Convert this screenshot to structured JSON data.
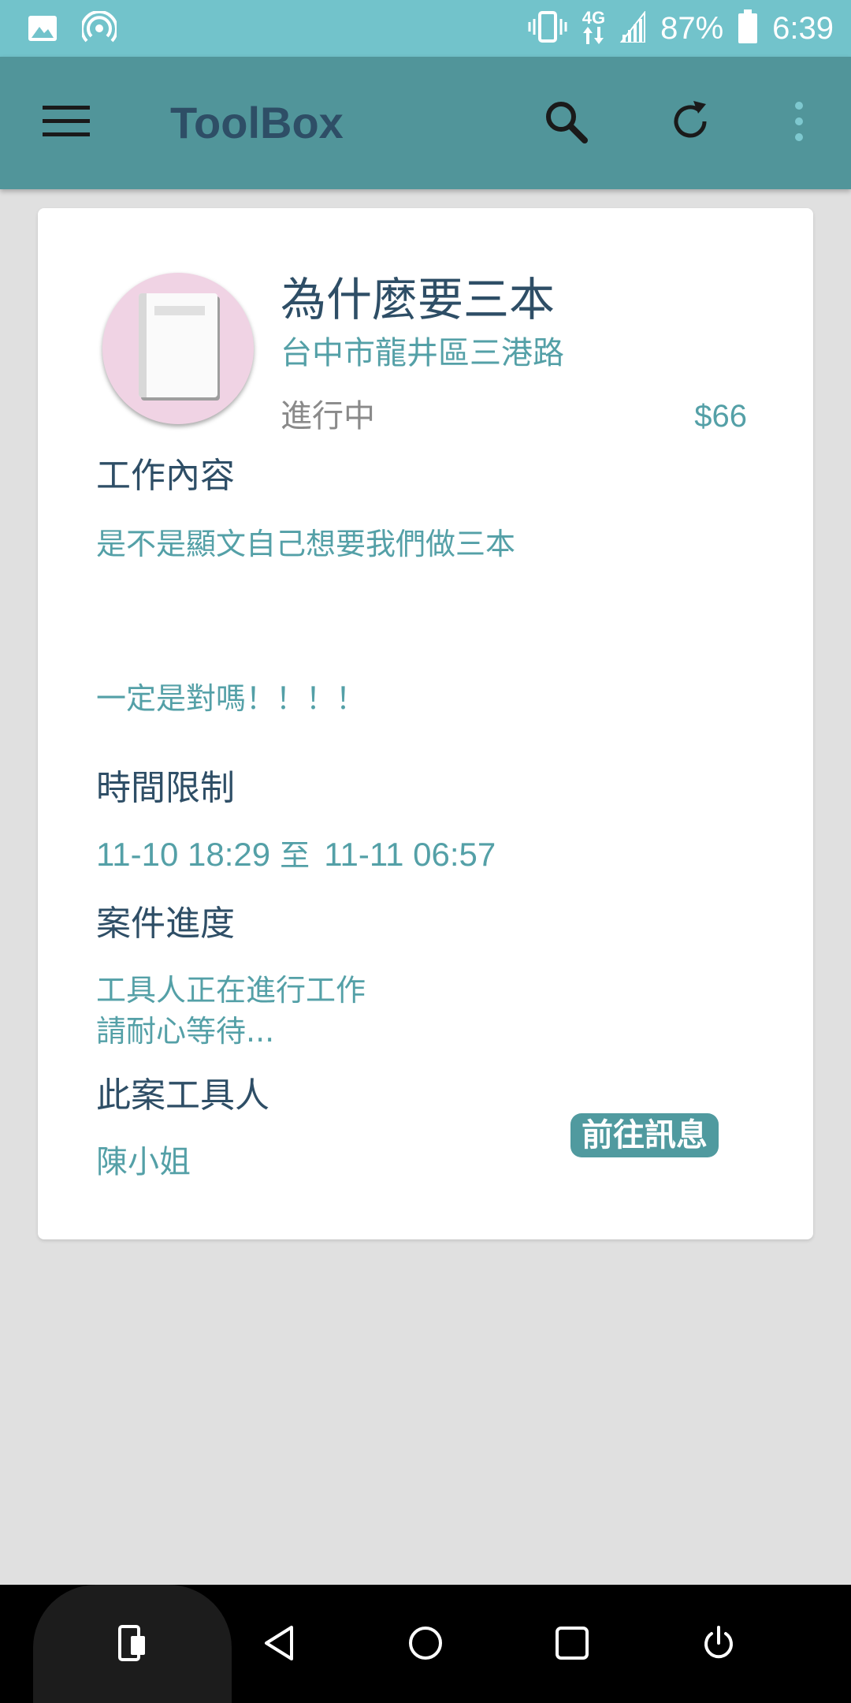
{
  "status_bar": {
    "battery_percent": "87%",
    "network": "4G",
    "time": "6:39",
    "icons": [
      "image-icon",
      "hotspot-icon",
      "vibrate-icon",
      "data-arrows-icon",
      "signal-icon",
      "battery-icon"
    ]
  },
  "app_bar": {
    "title": "ToolBox",
    "icons": [
      "menu-icon",
      "search-icon",
      "refresh-icon",
      "more-vert-icon"
    ]
  },
  "card": {
    "avatar_icon": "book-icon",
    "title": "為什麼要三本",
    "address": "台中市龍井區三港路",
    "status": "進行中",
    "price": "$66",
    "work_content": {
      "heading": "工作內容",
      "line1": "是不是顯文自己想要我們做三本",
      "line2": "一定是對嗎！！！！"
    },
    "time_limit": {
      "heading": "時間限制",
      "start": "11-10 18:29",
      "separator": "至",
      "end": "11-11 06:57"
    },
    "progress": {
      "heading": "案件進度",
      "line1": "工具人正在進行工作",
      "line2": "請耐心等待..."
    },
    "worker": {
      "heading": "此案工具人",
      "name": "陳小姐",
      "message_button": "前往訊息"
    }
  },
  "colors": {
    "status_bar": "#72c3cb",
    "app_bar": "#51959a",
    "title_text": "#2e4e66",
    "accent_text": "#54a0a7",
    "button_bg": "#509a9f",
    "background": "#e0e0e0"
  },
  "nav_bar": {
    "icons": [
      "screen-rotate-icon",
      "back-icon",
      "home-icon",
      "recents-icon",
      "power-icon"
    ]
  }
}
